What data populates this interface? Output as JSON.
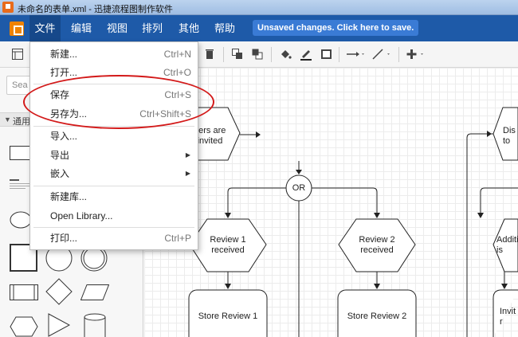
{
  "window": {
    "title": "未命名的表单.xml - 迅捷流程图制作软件"
  },
  "menubar": {
    "items": [
      "文件",
      "编辑",
      "视图",
      "排列",
      "其他",
      "帮助"
    ],
    "unsaved_notice": "Unsaved changes. Click here to save."
  },
  "file_menu": {
    "items": [
      {
        "label": "新建...",
        "shortcut": "Ctrl+N"
      },
      {
        "label": "打开...",
        "shortcut": "Ctrl+O"
      },
      {
        "label": "保存",
        "shortcut": "Ctrl+S"
      },
      {
        "label": "另存为...",
        "shortcut": "Ctrl+Shift+S"
      },
      {
        "label": "导入...",
        "shortcut": ""
      },
      {
        "label": "导出",
        "shortcut": "",
        "submenu": true
      },
      {
        "label": "嵌入",
        "shortcut": "",
        "submenu": true
      },
      {
        "label": "新建库...",
        "shortcut": ""
      },
      {
        "label": "Open Library...",
        "shortcut": ""
      },
      {
        "label": "打印...",
        "shortcut": "Ctrl+P"
      }
    ]
  },
  "sidebar": {
    "search_placeholder": "Sea",
    "section_label": "通用"
  },
  "canvas": {
    "nodes": {
      "invited": "vers are\ninvited",
      "or": "OR",
      "review1": "Review 1\nreceived",
      "review2": "Review 2\nreceived",
      "store1": "Store Review 1",
      "store2": "Store Review 2",
      "dis": "Dis\nto",
      "addit": "Additi\nis",
      "invit": "Invit\nr"
    }
  },
  "colors": {
    "menubar": "#1e5aa8",
    "annotation": "#d31a1a",
    "unsaved": "#3a7bd5"
  }
}
